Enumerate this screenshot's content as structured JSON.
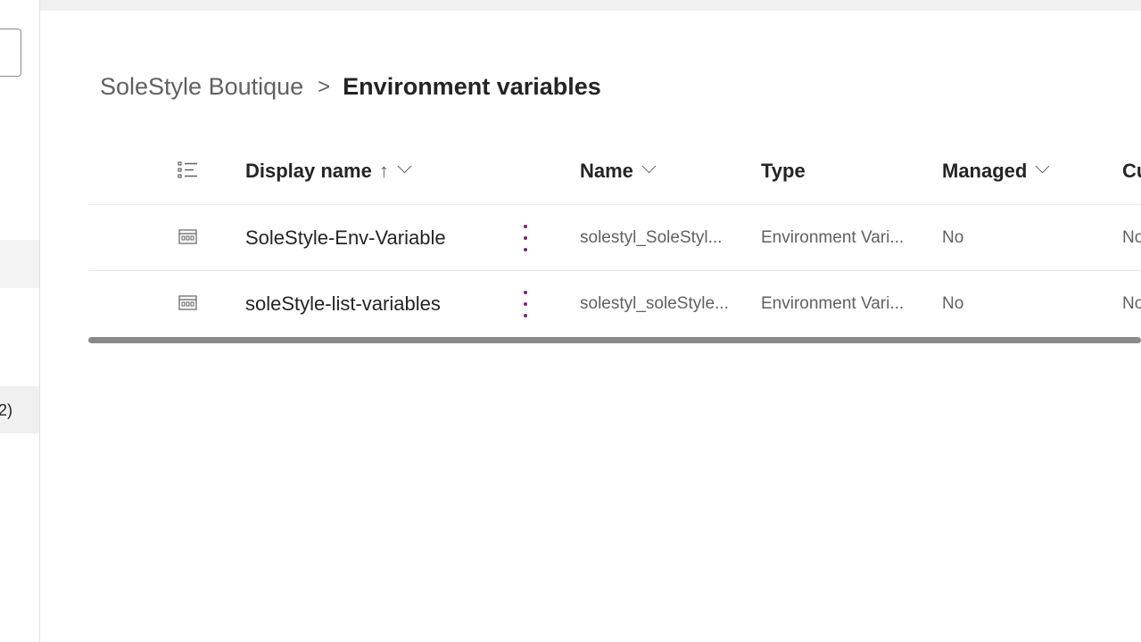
{
  "left_pane": {
    "partial_item_text": "2)"
  },
  "breadcrumb": {
    "root": "SoleStyle Boutique",
    "separator": ">",
    "current": "Environment variables"
  },
  "grid": {
    "columns": [
      {
        "key": "display_name",
        "label": "Display name",
        "sort_arrow": "↑",
        "has_menu": true
      },
      {
        "key": "name",
        "label": "Name",
        "has_menu": true
      },
      {
        "key": "type",
        "label": "Type",
        "has_menu": false
      },
      {
        "key": "managed",
        "label": "Managed",
        "has_menu": true
      },
      {
        "key": "customizable",
        "label": "Cu",
        "has_menu": false
      }
    ],
    "rows": [
      {
        "display_name": "SoleStyle-Env-Variable",
        "name": "solestyl_SoleStyl...",
        "type": "Environment Vari...",
        "managed": "No",
        "customizable": "No"
      },
      {
        "display_name": "soleStyle-list-variables",
        "name": "solestyl_soleStyle...",
        "type": "Environment Vari...",
        "managed": "No",
        "customizable": "No"
      }
    ]
  },
  "icons": {
    "list_icon": "list-view-icon",
    "row_icon": "environment-variable-icon",
    "more_icon": "more-vertical-icon"
  },
  "colors": {
    "accent": "#742774",
    "text_primary": "#242424",
    "text_secondary": "#616161"
  }
}
